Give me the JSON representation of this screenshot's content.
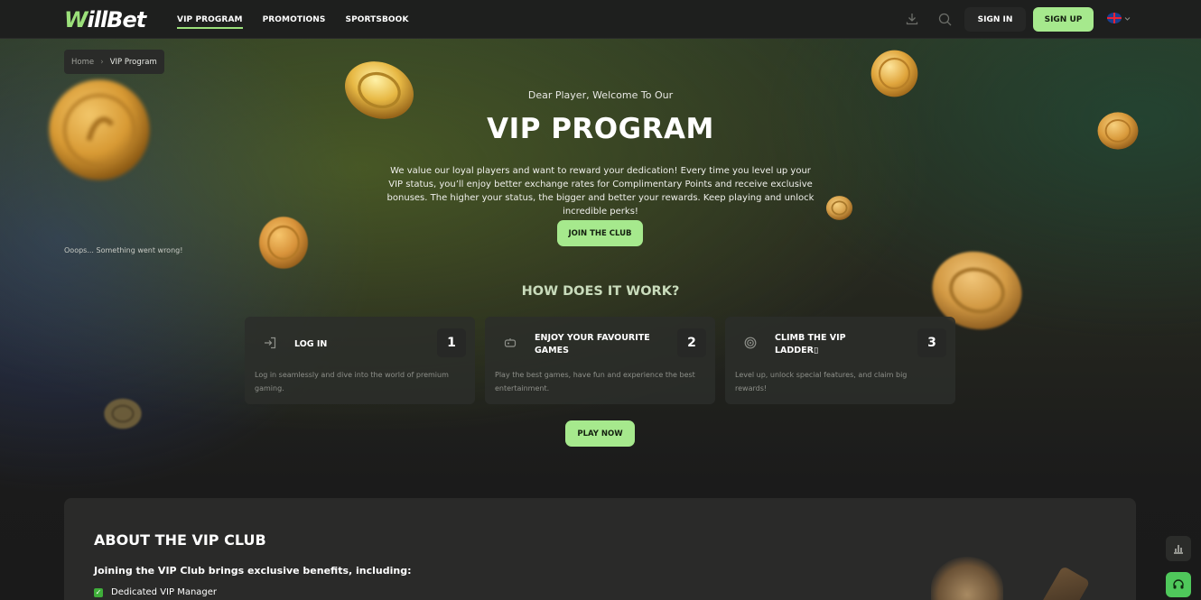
{
  "header": {
    "logo": {
      "prefix": "W",
      "rest": "illBet"
    },
    "nav": [
      {
        "label": "VIP PROGRAM",
        "active": true
      },
      {
        "label": "PROMOTIONS",
        "active": false
      },
      {
        "label": "SPORTSBOOK",
        "active": false
      }
    ],
    "sign_in": "SIGN IN",
    "sign_up": "SIGN UP",
    "icons": [
      "download-icon",
      "search-icon",
      "uk-flag-icon",
      "chevron-down-icon"
    ]
  },
  "breadcrumb": {
    "home": "Home",
    "separator": "›",
    "current": "VIP Program"
  },
  "error_message": "Ooops... Something went wrong!",
  "hero": {
    "subtitle": "Dear Player, Welcome To Our",
    "title": "VIP PROGRAM",
    "description": "We value our loyal players and want to reward your dedication! Every time you level up your VIP status, you’ll enjoy better exchange rates for Complimentary Points and receive exclusive bonuses. The higher your status, the bigger and better your rewards. Keep playing and unlock incredible perks!",
    "cta": "JOIN THE CLUB"
  },
  "how": {
    "title": "HOW DOES IT WORK?",
    "steps": [
      {
        "title": "LOG IN",
        "number": "1",
        "description": "Log in seamlessly and dive into the world of premium gaming.",
        "icon": "login-icon"
      },
      {
        "title": "ENJOY YOUR FAVOURITE GAMES",
        "number": "2",
        "description": "Play the best games, have fun and experience the best entertainment.",
        "icon": "gamepad-icon"
      },
      {
        "title": "CLIMB THE VIP LADDER▯",
        "number": "3",
        "description": "Level up, unlock special features, and claim big rewards!",
        "icon": "target-icon"
      }
    ],
    "cta": "PLAY NOW"
  },
  "about": {
    "title": "ABOUT THE VIP CLUB",
    "subtitle": "Joining the VIP Club brings exclusive benefits, including:",
    "items": [
      "Dedicated VIP Manager"
    ]
  },
  "colors": {
    "accent": "#a6e98d",
    "header_bg": "#1e1f1e",
    "card_bg": "#2c2e2a",
    "support_green": "#4fc85b"
  }
}
